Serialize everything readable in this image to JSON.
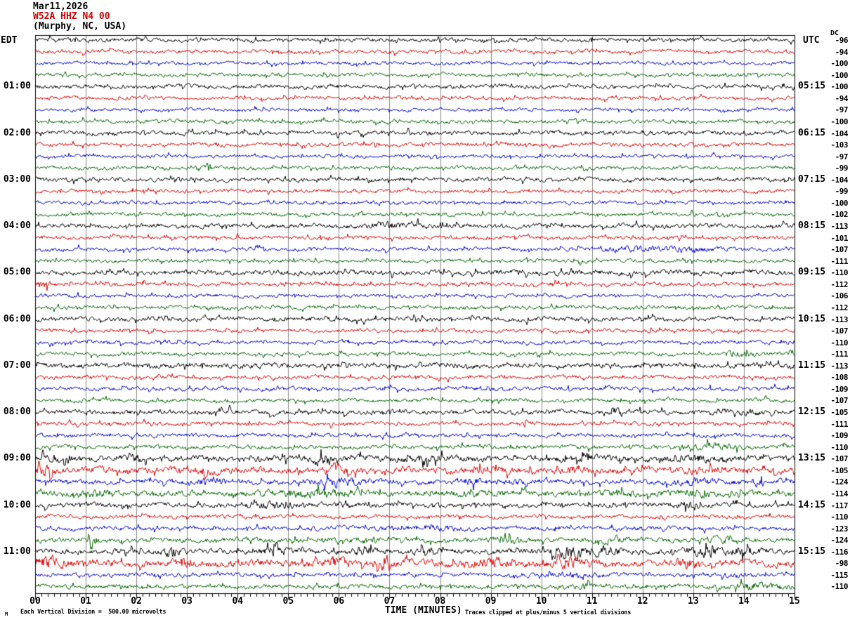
{
  "header": {
    "date": "Mar11,2026",
    "station": "W52A HHZ N4 00",
    "location": "(Murphy, NC, USA)",
    "left_timezone": "EDT",
    "right_timezone": "UTC",
    "dc_label": "DC"
  },
  "footer": {
    "axis_title": "TIME (MINUTES)",
    "scale_note": "Each Vertical Division =  500.00 microvolts",
    "clip_note": "Traces clipped at plus/minus 5 vertical divisions",
    "corner_glyph": "M"
  },
  "palette": {
    "black": "#000000",
    "red": "#dd0000",
    "blue": "#0000cc",
    "green": "#006600",
    "grid": "#888888",
    "station_line": "#cc0000"
  },
  "chart_data": {
    "type": "line",
    "subtype": "helicorder-seismogram",
    "title": "W52A HHZ N4 00 (Murphy, NC, USA) Mar11,2026",
    "xlabel": "TIME (MINUTES)",
    "x_axis": {
      "minutes": 15,
      "minor_divisions": 8,
      "ticks": [
        "00",
        "01",
        "02",
        "03",
        "04",
        "05",
        "06",
        "07",
        "08",
        "09",
        "10",
        "11",
        "12",
        "13",
        "14",
        "15"
      ]
    },
    "trace_color_cycle": [
      "black",
      "red",
      "blue",
      "green"
    ],
    "rows": [
      {
        "edt": "",
        "utc": "",
        "dc": "-96",
        "color": "black",
        "amp": 2.6,
        "bursts": []
      },
      {
        "edt": "",
        "utc": "",
        "dc": "-94",
        "color": "red",
        "amp": 2.4,
        "bursts": []
      },
      {
        "edt": "",
        "utc": "",
        "dc": "-100",
        "color": "blue",
        "amp": 2.2,
        "bursts": []
      },
      {
        "edt": "",
        "utc": "",
        "dc": "-100",
        "color": "green",
        "amp": 2.3,
        "bursts": []
      },
      {
        "edt": "01:00",
        "utc": "05:15",
        "dc": "-100",
        "color": "black",
        "amp": 2.7,
        "bursts": []
      },
      {
        "edt": "",
        "utc": "",
        "dc": "-94",
        "color": "red",
        "amp": 2.4,
        "bursts": []
      },
      {
        "edt": "",
        "utc": "",
        "dc": "-97",
        "color": "blue",
        "amp": 2.2,
        "bursts": []
      },
      {
        "edt": "",
        "utc": "",
        "dc": "-100",
        "color": "green",
        "amp": 2.4,
        "bursts": []
      },
      {
        "edt": "02:00",
        "utc": "06:15",
        "dc": "-104",
        "color": "black",
        "amp": 2.8,
        "bursts": []
      },
      {
        "edt": "",
        "utc": "",
        "dc": "-103",
        "color": "red",
        "amp": 2.5,
        "bursts": []
      },
      {
        "edt": "",
        "utc": "",
        "dc": "-97",
        "color": "blue",
        "amp": 2.2,
        "bursts": []
      },
      {
        "edt": "",
        "utc": "",
        "dc": "-99",
        "color": "green",
        "amp": 2.3,
        "bursts": [
          [
            3.43,
            6,
            0.05
          ]
        ]
      },
      {
        "edt": "03:00",
        "utc": "07:15",
        "dc": "-104",
        "color": "black",
        "amp": 2.8,
        "bursts": []
      },
      {
        "edt": "",
        "utc": "",
        "dc": "-99",
        "color": "red",
        "amp": 2.4,
        "bursts": []
      },
      {
        "edt": "",
        "utc": "",
        "dc": "-100",
        "color": "blue",
        "amp": 2.3,
        "bursts": []
      },
      {
        "edt": "",
        "utc": "",
        "dc": "-102",
        "color": "green",
        "amp": 2.4,
        "bursts": []
      },
      {
        "edt": "04:00",
        "utc": "08:15",
        "dc": "-113",
        "color": "black",
        "amp": 3.0,
        "bursts": [
          [
            7.2,
            2,
            0.6
          ]
        ]
      },
      {
        "edt": "",
        "utc": "",
        "dc": "-101",
        "color": "red",
        "amp": 2.4,
        "bursts": []
      },
      {
        "edt": "",
        "utc": "",
        "dc": "-107",
        "color": "blue",
        "amp": 2.5,
        "bursts": [
          [
            11.8,
            2.5,
            0.7
          ],
          [
            13.0,
            2.5,
            0.5
          ]
        ]
      },
      {
        "edt": "",
        "utc": "",
        "dc": "-111",
        "color": "green",
        "amp": 2.4,
        "bursts": []
      },
      {
        "edt": "05:00",
        "utc": "09:15",
        "dc": "-110",
        "color": "black",
        "amp": 3.3,
        "bursts": []
      },
      {
        "edt": "",
        "utc": "",
        "dc": "-112",
        "color": "red",
        "amp": 2.6,
        "bursts": [
          [
            0.15,
            4,
            0.15
          ]
        ]
      },
      {
        "edt": "",
        "utc": "",
        "dc": "-106",
        "color": "blue",
        "amp": 2.3,
        "bursts": []
      },
      {
        "edt": "",
        "utc": "",
        "dc": "-112",
        "color": "green",
        "amp": 2.5,
        "bursts": []
      },
      {
        "edt": "06:00",
        "utc": "10:15",
        "dc": "-113",
        "color": "black",
        "amp": 3.0,
        "bursts": []
      },
      {
        "edt": "",
        "utc": "",
        "dc": "-107",
        "color": "red",
        "amp": 2.4,
        "bursts": []
      },
      {
        "edt": "",
        "utc": "",
        "dc": "-110",
        "color": "blue",
        "amp": 2.4,
        "bursts": []
      },
      {
        "edt": "",
        "utc": "",
        "dc": "-111",
        "color": "green",
        "amp": 2.5,
        "bursts": [
          [
            13.9,
            2.5,
            0.3
          ]
        ]
      },
      {
        "edt": "07:00",
        "utc": "11:15",
        "dc": "-113",
        "color": "black",
        "amp": 3.3,
        "bursts": []
      },
      {
        "edt": "",
        "utc": "",
        "dc": "-108",
        "color": "red",
        "amp": 2.5,
        "bursts": []
      },
      {
        "edt": "",
        "utc": "",
        "dc": "-109",
        "color": "blue",
        "amp": 2.6,
        "bursts": []
      },
      {
        "edt": "",
        "utc": "",
        "dc": "-107",
        "color": "green",
        "amp": 2.5,
        "bursts": []
      },
      {
        "edt": "08:00",
        "utc": "12:15",
        "dc": "-105",
        "color": "black",
        "amp": 3.1,
        "bursts": [
          [
            11.5,
            4.5,
            0.12
          ],
          [
            13.9,
            1.5,
            0.5
          ]
        ]
      },
      {
        "edt": "",
        "utc": "",
        "dc": "-111",
        "color": "red",
        "amp": 2.5,
        "bursts": [
          [
            9.7,
            2.5,
            0.15
          ]
        ]
      },
      {
        "edt": "",
        "utc": "",
        "dc": "-109",
        "color": "blue",
        "amp": 2.5,
        "bursts": []
      },
      {
        "edt": "",
        "utc": "",
        "dc": "-110",
        "color": "green",
        "amp": 2.7,
        "bursts": [
          [
            13.4,
            3,
            0.5
          ]
        ]
      },
      {
        "edt": "09:00",
        "utc": "13:15",
        "dc": "-107",
        "color": "black",
        "amp": 4.0,
        "bursts": [
          [
            0.55,
            4,
            0.2
          ],
          [
            2.05,
            2.5,
            0.15
          ],
          [
            5.7,
            5,
            0.2
          ],
          [
            7.8,
            2.5,
            0.3
          ],
          [
            10.9,
            5,
            0.15
          ],
          [
            13.1,
            2.5,
            0.4
          ]
        ]
      },
      {
        "edt": "",
        "utc": "",
        "dc": "-105",
        "color": "red",
        "amp": 4.2,
        "bursts": [
          [
            0.12,
            6,
            0.25
          ],
          [
            3.4,
            3.5,
            0.2
          ],
          [
            5.95,
            4.5,
            0.2
          ],
          [
            9.0,
            2.5,
            0.3
          ],
          [
            10.6,
            3.5,
            0.2
          ],
          [
            13.0,
            2.5,
            0.3
          ]
        ]
      },
      {
        "edt": "",
        "utc": "",
        "dc": "-124",
        "color": "blue",
        "amp": 3.3,
        "bursts": [
          [
            3.5,
            2.5,
            0.3
          ],
          [
            6.0,
            3.5,
            0.5
          ],
          [
            8.6,
            2.5,
            0.3
          ],
          [
            9.6,
            2.5,
            0.25
          ],
          [
            12.9,
            3.5,
            0.35
          ],
          [
            14.2,
            3,
            0.25
          ]
        ]
      },
      {
        "edt": "",
        "utc": "",
        "dc": "-114",
        "color": "green",
        "amp": 3.8,
        "bursts": [
          [
            1.2,
            2.5,
            0.3
          ],
          [
            5.4,
            3.5,
            0.7
          ],
          [
            8.6,
            2.5,
            0.35
          ],
          [
            11.6,
            2.5,
            0.35
          ],
          [
            13.0,
            2.5,
            0.3
          ]
        ]
      },
      {
        "edt": "10:00",
        "utc": "14:15",
        "dc": "-117",
        "color": "black",
        "amp": 3.1,
        "bursts": [
          [
            4.6,
            2.5,
            0.5
          ],
          [
            6.1,
            2,
            0.2
          ],
          [
            12.9,
            4.5,
            0.2
          ]
        ]
      },
      {
        "edt": "",
        "utc": "",
        "dc": "-110",
        "color": "red",
        "amp": 2.5,
        "bursts": []
      },
      {
        "edt": "",
        "utc": "",
        "dc": "-123",
        "color": "blue",
        "amp": 2.8,
        "bursts": [
          [
            7.8,
            2,
            0.7
          ]
        ]
      },
      {
        "edt": "",
        "utc": "",
        "dc": "-124",
        "color": "green",
        "amp": 3.1,
        "bursts": [
          [
            1.15,
            5.5,
            0.1
          ],
          [
            6.6,
            2.5,
            0.25
          ],
          [
            9.4,
            2.5,
            0.25
          ],
          [
            11.4,
            2.5,
            0.25
          ],
          [
            13.6,
            2.5,
            0.3
          ]
        ]
      },
      {
        "edt": "11:00",
        "utc": "15:15",
        "dc": "-116",
        "color": "black",
        "amp": 3.5,
        "bursts": [
          [
            2.7,
            5.5,
            0.15
          ],
          [
            4.75,
            5.5,
            0.2
          ],
          [
            6.5,
            3.5,
            0.25
          ],
          [
            7.75,
            4.5,
            0.2
          ],
          [
            10.6,
            6,
            0.45
          ],
          [
            11.3,
            4.5,
            0.25
          ],
          [
            13.3,
            5,
            0.4
          ],
          [
            14.0,
            4.5,
            0.25
          ]
        ]
      },
      {
        "edt": "",
        "utc": "",
        "dc": "-98",
        "color": "red",
        "amp": 4.6,
        "bursts": [
          [
            0.25,
            6.5,
            0.3
          ],
          [
            2.95,
            5.5,
            0.15
          ],
          [
            5.95,
            4.5,
            0.15
          ],
          [
            6.8,
            3.5,
            0.15
          ],
          [
            9.0,
            3,
            0.5
          ],
          [
            10.5,
            4.5,
            0.2
          ],
          [
            12.9,
            4.5,
            0.15
          ]
        ]
      },
      {
        "edt": "",
        "utc": "",
        "dc": "-115",
        "color": "blue",
        "amp": 2.6,
        "bursts": [
          [
            6.7,
            6.5,
            0.04
          ],
          [
            10.5,
            2,
            0.7
          ],
          [
            13.8,
            1.5,
            0.3
          ]
        ]
      },
      {
        "edt": "",
        "utc": "",
        "dc": "-110",
        "color": "green",
        "amp": 2.9,
        "bursts": [
          [
            10.9,
            2.5,
            0.2
          ],
          [
            14.2,
            3.5,
            0.5
          ]
        ]
      }
    ]
  }
}
